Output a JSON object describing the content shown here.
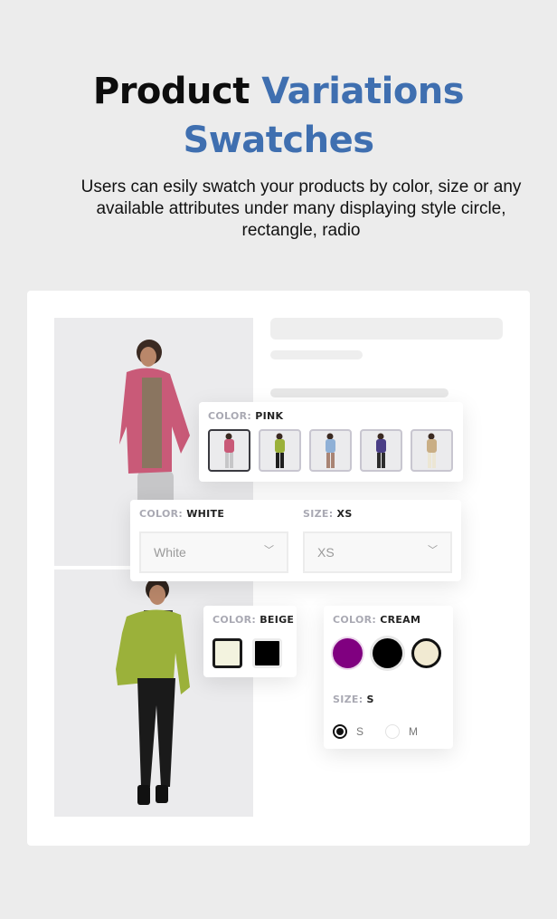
{
  "hero": {
    "title_dark": "Product",
    "title_accent_1": "Variations",
    "title_accent_2": "Swatches",
    "subtitle": "Users can esily swatch your products by color, size or any available attributes under many displaying style circle, rectangle, radio"
  },
  "colors": {
    "accent": "#3f6fb0",
    "background": "#ececec"
  },
  "photos": [
    {
      "name": "model-pink-fleece-jacket",
      "jacket_color": "#c95a78"
    },
    {
      "name": "model-green-fleece-jacket",
      "jacket_color": "#9bb13a"
    }
  ],
  "image_swatch_popup": {
    "key": "COLOR:",
    "value": "PINK",
    "thumbnails": [
      {
        "name": "pink",
        "jacket": "#c95a78",
        "pants": "#c6c6c8",
        "selected": true
      },
      {
        "name": "green",
        "jacket": "#9bb13a",
        "pants": "#1e1e1e",
        "selected": false
      },
      {
        "name": "blue",
        "jacket": "#8fb0d6",
        "pants": "#a98474",
        "selected": false
      },
      {
        "name": "navy",
        "jacket": "#4a3e86",
        "pants": "#2d2d2d",
        "selected": false
      },
      {
        "name": "beige",
        "jacket": "#c9ae85",
        "pants": "#ece6d4",
        "selected": false
      }
    ]
  },
  "dropdown_popup": {
    "color_key": "COLOR:",
    "color_value": "WHITE",
    "color_selected": "White",
    "size_key": "SIZE:",
    "size_value": "XS",
    "size_selected": "XS",
    "chevron": "﹀"
  },
  "square_swatch_popup": {
    "key": "COLOR:",
    "value": "BEIGE",
    "swatches": [
      {
        "name": "beige",
        "color": "#f3f3df",
        "selected": true
      },
      {
        "name": "black",
        "color": "#000000",
        "selected": false
      }
    ]
  },
  "circle_radio_popup": {
    "color_key": "COLOR:",
    "color_value": "CREAM",
    "swatches": [
      {
        "name": "purple",
        "color": "#800080",
        "selected": false
      },
      {
        "name": "black",
        "color": "#000000",
        "selected": false
      },
      {
        "name": "cream",
        "color": "#f1ead2",
        "selected": true
      }
    ],
    "size_key": "SIZE:",
    "size_value": "S",
    "radios": [
      {
        "label": "S",
        "checked": true
      },
      {
        "label": "M",
        "checked": false
      }
    ]
  }
}
